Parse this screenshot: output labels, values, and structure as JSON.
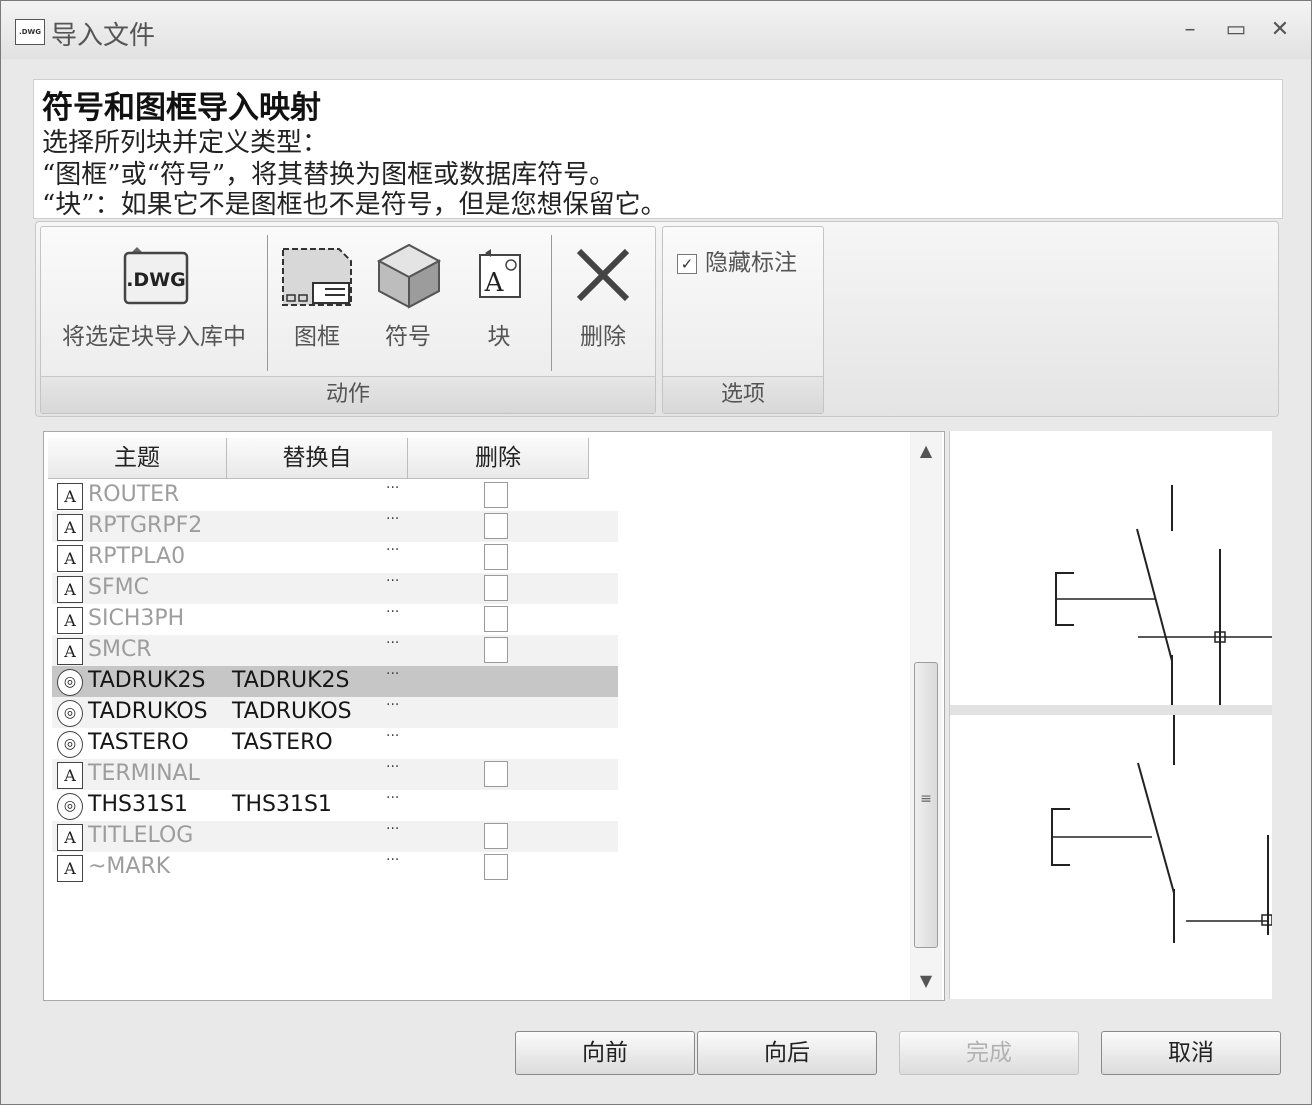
{
  "window": {
    "title": "导入文件",
    "app_icon_text": ".DWG",
    "minimize": "–",
    "maximize": "▭",
    "close": "✕"
  },
  "header": {
    "title": "符号和图框导入映射",
    "line1": "选择所列块并定义类型：",
    "line2": "“图框”或“符号”，将其替换为图框或数据库符号。",
    "line3": "“块”：如果它不是图框也不是符号，但是您想保留它。"
  },
  "ribbon": {
    "import_label": "将选定块导入库中",
    "import_icon_text": ".DWG",
    "frame_label": "图框",
    "symbol_label": "符号",
    "block_label": "块",
    "delete_label": "删除",
    "actions_group": "动作",
    "hide_annotation_label": "隐藏标注",
    "hide_annotation_checked": true,
    "options_group": "选项"
  },
  "table": {
    "columns": [
      "主题",
      "替换自",
      "删除"
    ],
    "rows": [
      {
        "name": "ROUTER",
        "replace": "",
        "dots": "···",
        "type": "block",
        "delete_box": true
      },
      {
        "name": "RPTGRPF2",
        "replace": "",
        "dots": "···",
        "type": "block",
        "delete_box": true
      },
      {
        "name": "RPTPLA0",
        "replace": "",
        "dots": "···",
        "type": "block",
        "delete_box": true
      },
      {
        "name": "SFMC",
        "replace": "",
        "dots": "···",
        "type": "block",
        "delete_box": true
      },
      {
        "name": "SICH3PH",
        "replace": "",
        "dots": "···",
        "type": "block",
        "delete_box": true
      },
      {
        "name": "SMCR",
        "replace": "",
        "dots": "···",
        "type": "block",
        "delete_box": true
      },
      {
        "name": "TADRUK2S",
        "replace": "TADRUK2S",
        "dots": "···",
        "type": "symbol",
        "delete_box": false,
        "selected": true
      },
      {
        "name": "TADRUKOS",
        "replace": "TADRUKOS",
        "dots": "···",
        "type": "symbol",
        "delete_box": false
      },
      {
        "name": "TASTERO",
        "replace": "TASTERO",
        "dots": "···",
        "type": "symbol",
        "delete_box": false
      },
      {
        "name": "TERMINAL",
        "replace": "",
        "dots": "···",
        "type": "block",
        "delete_box": true
      },
      {
        "name": "THS31S1",
        "replace": "THS31S1",
        "dots": "···",
        "type": "symbol",
        "delete_box": false
      },
      {
        "name": "TITLELOG",
        "replace": "",
        "dots": "···",
        "type": "block",
        "delete_box": true
      },
      {
        "name": "~MARK",
        "replace": "",
        "dots": "···",
        "type": "block",
        "delete_box": true
      }
    ]
  },
  "footer": {
    "back": "向前",
    "next": "向后",
    "finish": "完成",
    "cancel": "取消"
  },
  "colors": {
    "selected_row": "#c6c6c6",
    "muted_text": "#9d9d9d"
  }
}
